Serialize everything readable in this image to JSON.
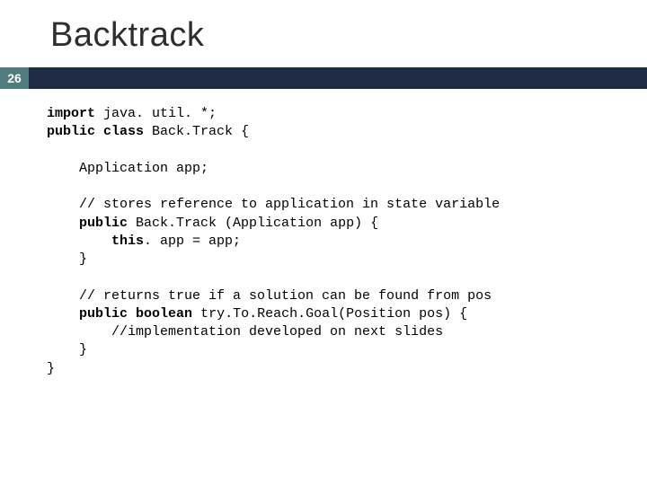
{
  "title": "Backtrack",
  "page_number": "26",
  "code": {
    "l1a": "import",
    "l1b": " java. util. *;",
    "l2a": "public",
    "l2b": " ",
    "l2c": "class",
    "l2d": " Back.Track {",
    "l3": "    Application app;",
    "l4": "    // stores reference to application in state variable",
    "l5a": "    ",
    "l5b": "public",
    "l5c": " Back.Track (Application app) {",
    "l6a": "        ",
    "l6b": "this",
    "l6c": ". app = app;",
    "l7": "    }",
    "l8": "    // returns true if a solution can be found from pos",
    "l9a": "    ",
    "l9b": "public",
    "l9c": " ",
    "l9d": "boolean",
    "l9e": " try.To.Reach.Goal(Position pos) {",
    "l10": "        //implementation developed on next slides",
    "l11": "    }",
    "l12": "}"
  }
}
